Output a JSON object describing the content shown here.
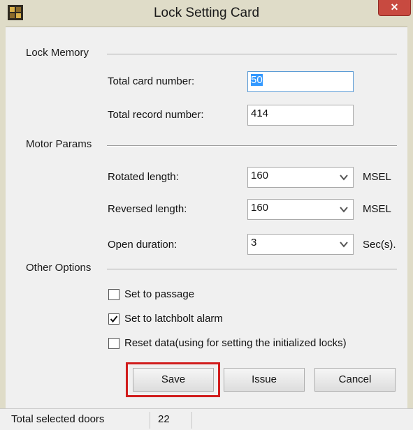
{
  "window": {
    "title": "Lock Setting Card",
    "close_label": "✕"
  },
  "lock_memory": {
    "section_label": "Lock Memory",
    "total_card_label": "Total card number:",
    "total_card_value": "50",
    "total_record_label": "Total record number:",
    "total_record_value": "414"
  },
  "motor_params": {
    "section_label": "Motor Params",
    "rotated_label": "Rotated length:",
    "rotated_value": "160",
    "rotated_unit": "MSEL",
    "reversed_label": "Reversed length:",
    "reversed_value": "160",
    "reversed_unit": "MSEL",
    "open_label": "Open duration:",
    "open_value": "3",
    "open_unit": "Sec(s)."
  },
  "other_options": {
    "section_label": "Other Options",
    "passage_label": "Set to passage",
    "passage_checked": false,
    "latchbolt_label": "Set to latchbolt alarm",
    "latchbolt_checked": true,
    "reset_label": "Reset data(using for setting the initialized locks)",
    "reset_checked": false
  },
  "buttons": {
    "save": "Save",
    "issue": "Issue",
    "cancel": "Cancel"
  },
  "status": {
    "label": "Total selected doors",
    "value": "22"
  },
  "colors": {
    "title_bar": "#dfdcc8",
    "close": "#c84a40",
    "highlight": "#d11c1c",
    "selection": "#3399ff"
  },
  "icons": {
    "app": "lock-card-app-icon",
    "dropdown": "chevron-down-icon",
    "check": "checkmark-icon"
  }
}
